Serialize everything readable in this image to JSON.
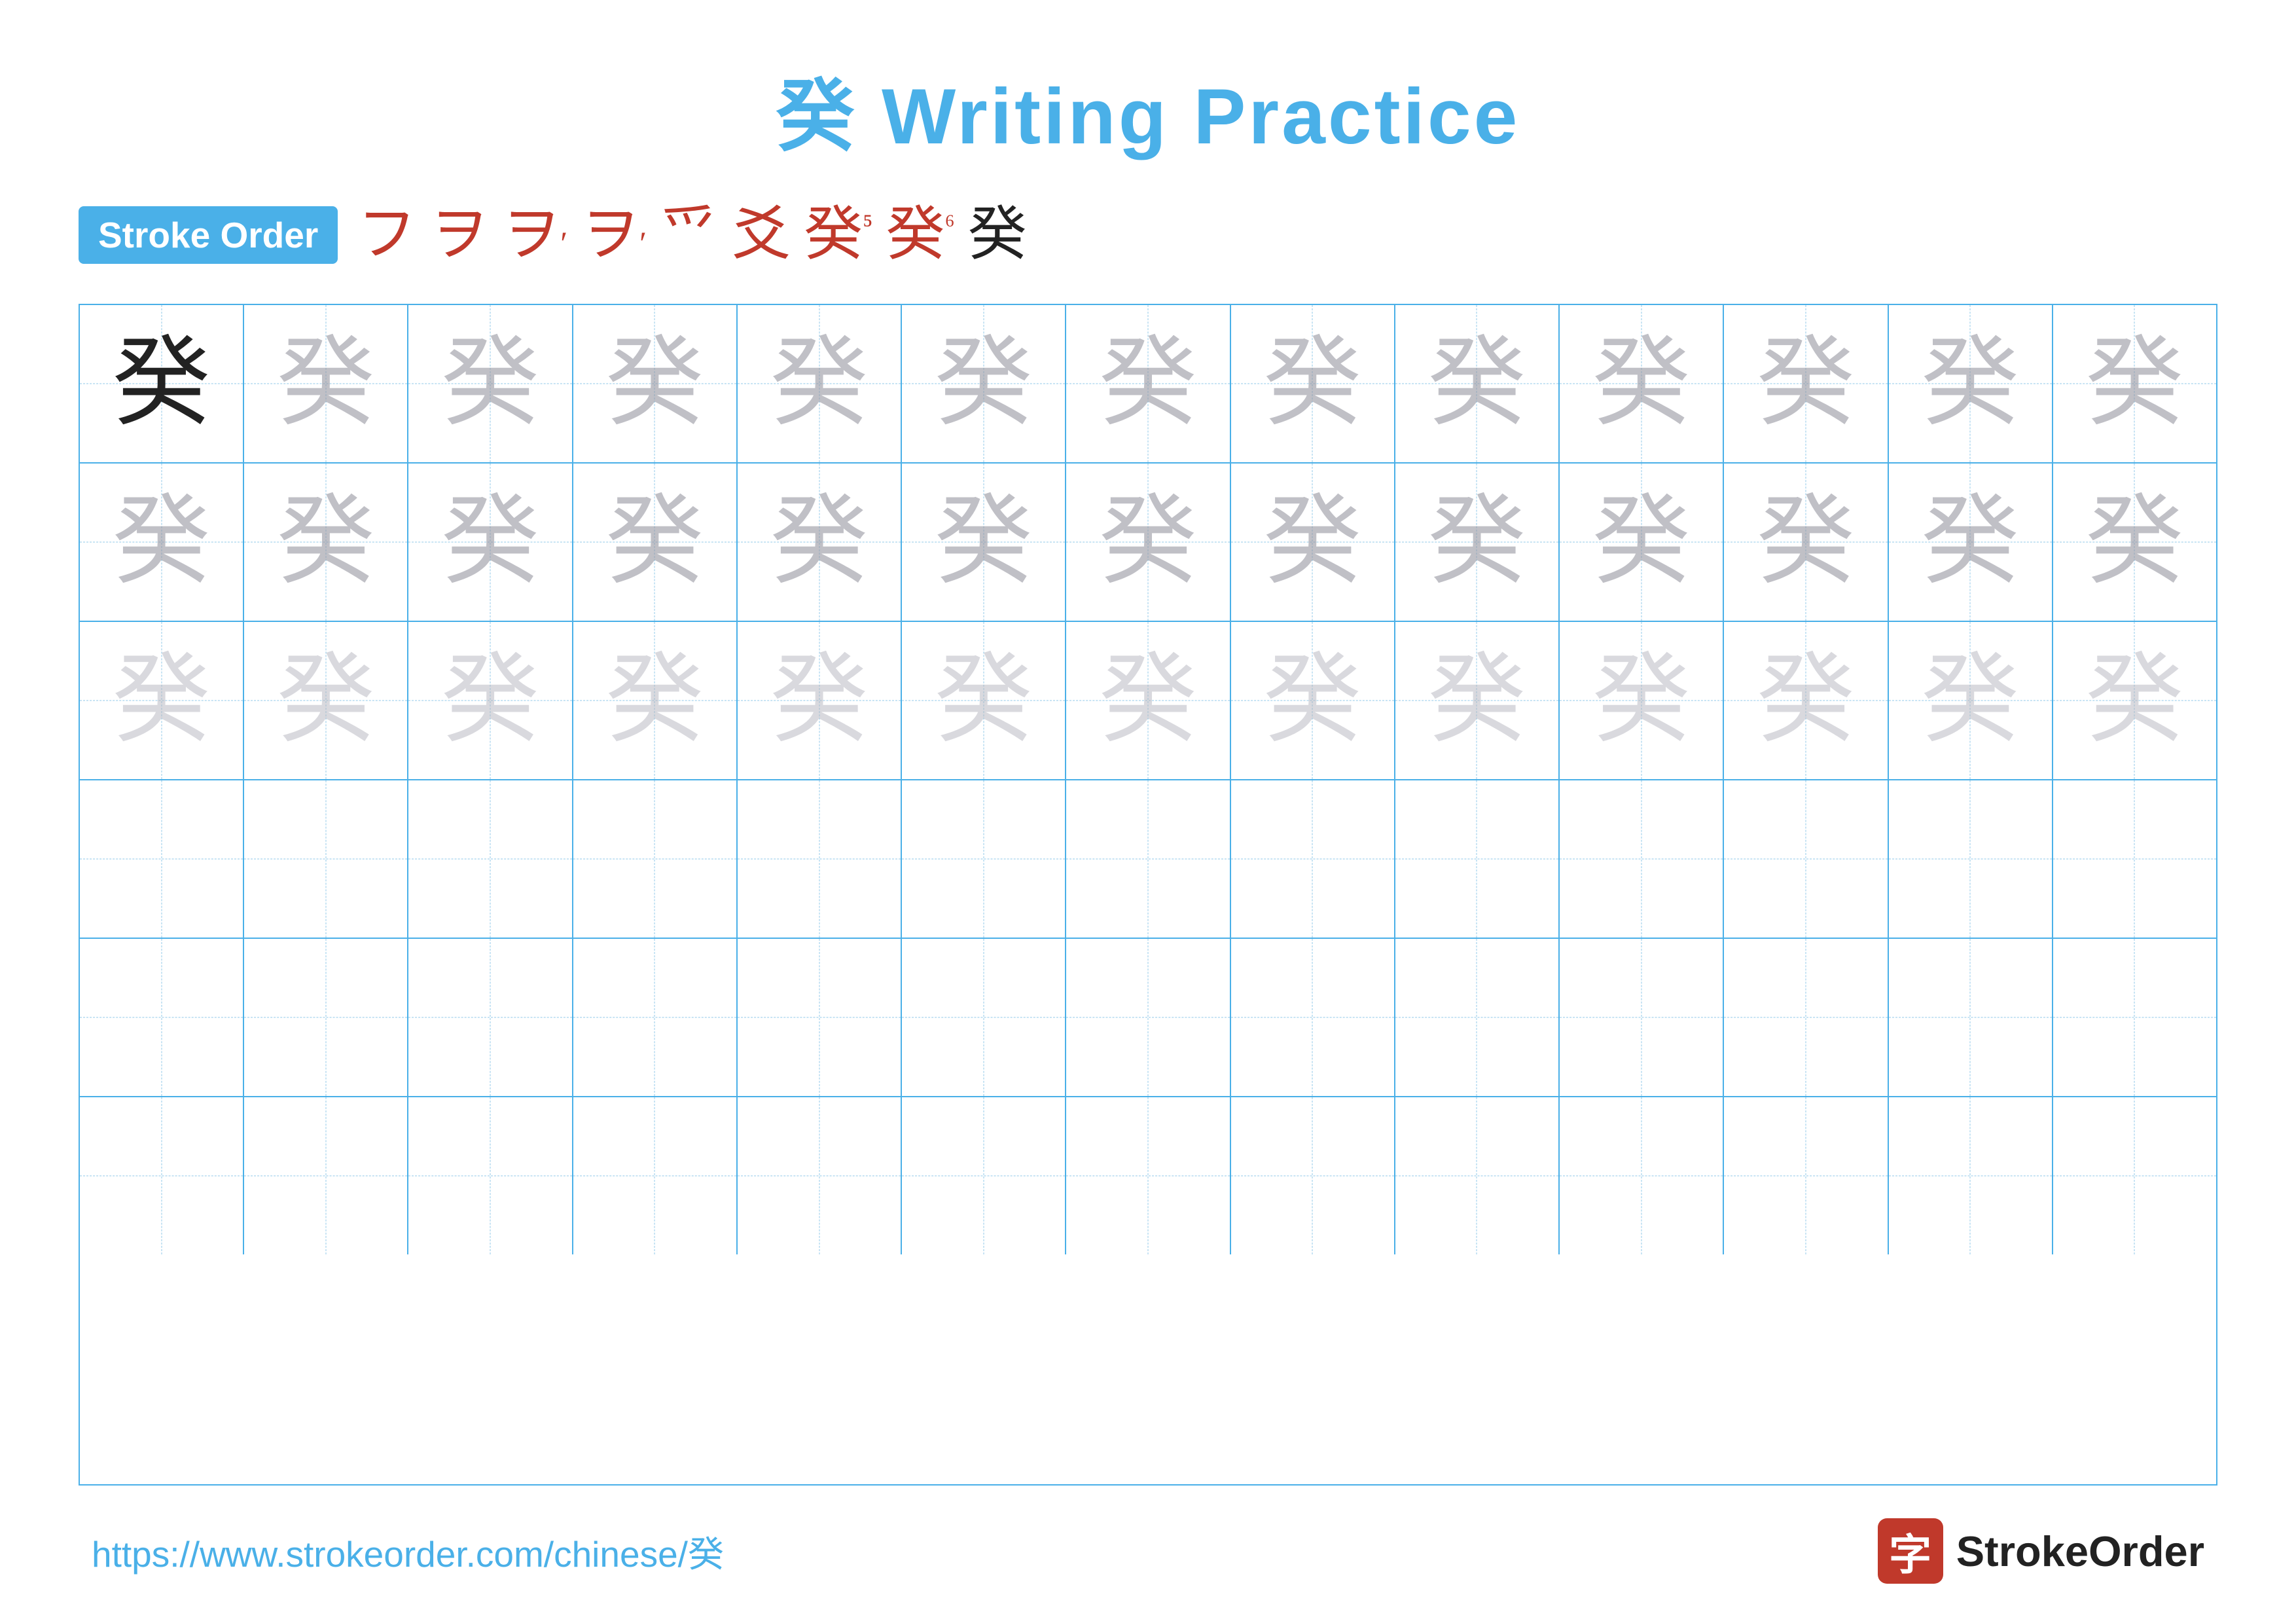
{
  "title": {
    "char": "癸",
    "text": " Writing Practice"
  },
  "stroke_order": {
    "badge_label": "Stroke Order",
    "strokes": [
      "フ",
      "ヲ",
      "ヲ'",
      "ヲ'",
      "爫",
      "爫丶",
      "癸⁵",
      "癸⁶",
      "癸"
    ]
  },
  "grid": {
    "rows": 6,
    "cols": 13,
    "char": "癸",
    "row_types": [
      "solid_then_ghost_dark",
      "ghost_dark",
      "ghost_medium",
      "empty",
      "empty",
      "empty"
    ]
  },
  "footer": {
    "url": "https://www.strokeorder.com/chinese/癸",
    "logo_char": "字",
    "logo_text": "StrokeOrder"
  }
}
